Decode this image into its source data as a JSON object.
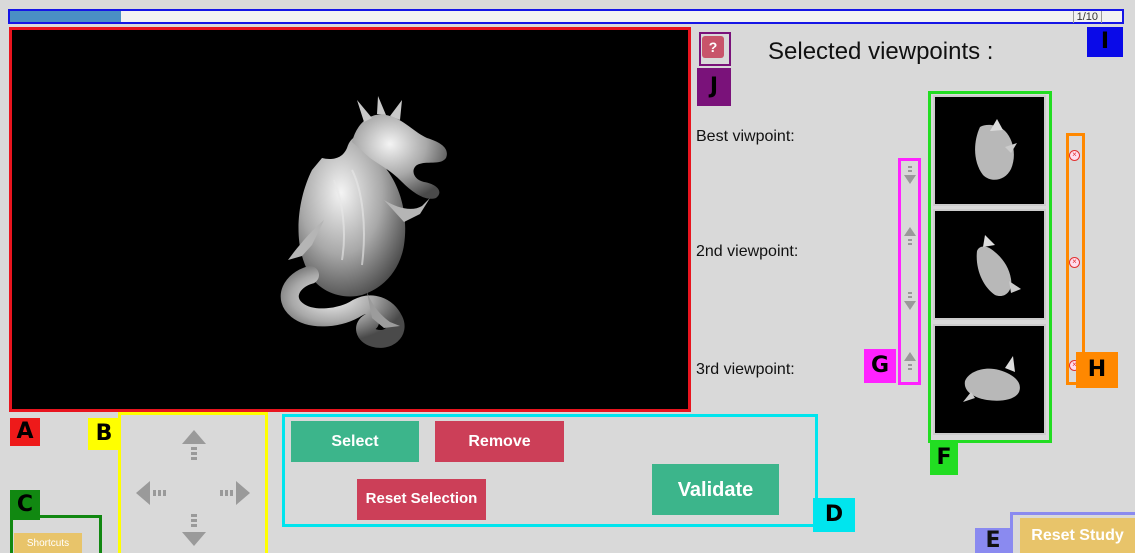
{
  "progress": {
    "text": "1/10",
    "fraction": 0.1
  },
  "section_tags": {
    "a": "A",
    "b": "B",
    "c": "C",
    "d": "D",
    "e": "E",
    "f": "F",
    "g": "G",
    "h": "H",
    "i": "I",
    "j": "J"
  },
  "help": {
    "icon": "question-icon",
    "glyph": "?"
  },
  "selected": {
    "title": "Selected viewpoints :",
    "labels": [
      "Best viwpoint:",
      "2nd viewpoint:",
      "3rd viewpoint:"
    ]
  },
  "buttons": {
    "select": "Select",
    "remove": "Remove",
    "reset_selection": "Reset Selection",
    "validate": "Validate",
    "shortcuts": "Shortcuts",
    "reset_study": "Reset Study"
  },
  "colors": {
    "green_button": "#3cb58b",
    "red_button": "#cc3f58",
    "yellow_button": "#e8c46a",
    "progress_fill": "#4a8fc4",
    "viewport_bg": "#000000"
  },
  "icons": {
    "nav": [
      "arrow-up-icon",
      "arrow-left-icon",
      "arrow-right-icon",
      "arrow-down-icon"
    ],
    "reorder": [
      "move-down-icon",
      "move-up-icon",
      "move-down-icon",
      "move-up-icon"
    ],
    "delete": "remove-viewpoint-icon",
    "model": "dragon-model"
  }
}
